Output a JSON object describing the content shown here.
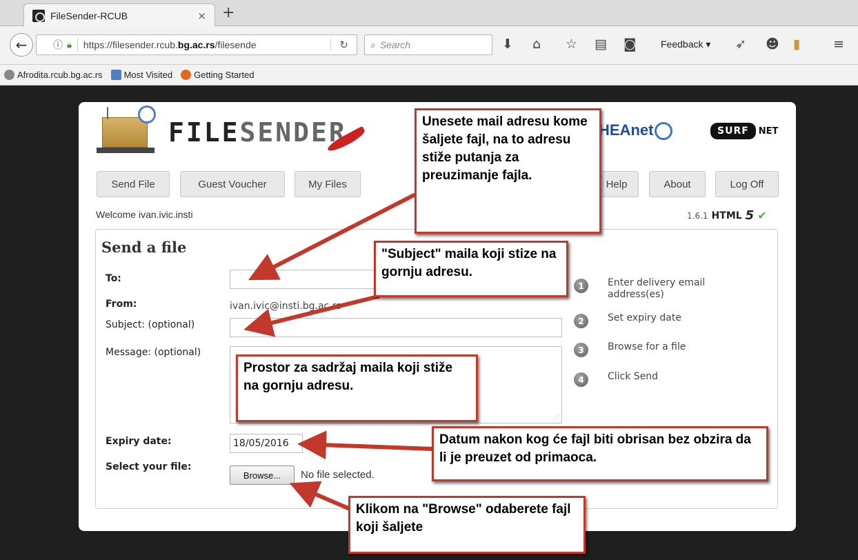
{
  "browser": {
    "tab_title": "FileSender-RCUB",
    "tab_close": "×",
    "new_tab": "+",
    "url_prefix": "https://filesender.rcub.",
    "url_domain": "bg.ac.rs",
    "url_suffix": "/filesende",
    "search_placeholder": "Search",
    "feedback_label": "Feedback ▾",
    "bookmarks": [
      "Afrodita.rcub.bg.ac.rs",
      "Most Visited",
      "Getting Started"
    ]
  },
  "header": {
    "logo_main": "FILE",
    "logo_lite": "SENDER",
    "heanet": "HEAnet",
    "surf": "SURF",
    "net": "NET"
  },
  "nav": {
    "send_file": "Send File",
    "guest_voucher": "Guest Voucher",
    "my_files": "My Files",
    "help": "Help",
    "about": "About",
    "log_off": "Log Off"
  },
  "welcome": "Welcome ivan.ivic.insti",
  "version": {
    "number": "1.6.1",
    "html": "HTML",
    "five": "5",
    "check": "✔"
  },
  "form": {
    "title": "Send a file",
    "to_label": "To:",
    "from_label": "From:",
    "from_value": "ivan.ivic@insti.bg.ac.rs",
    "subject_label": "Subject: (optional)",
    "message_label": "Message: (optional)",
    "expiry_label": "Expiry date:",
    "expiry_value": "18/05/2016",
    "file_label": "Select your file:",
    "browse_label": "Browse...",
    "no_file": "No file selected."
  },
  "steps": [
    {
      "num": "1",
      "text": "Enter delivery email address(es)"
    },
    {
      "num": "2",
      "text": "Set expiry date"
    },
    {
      "num": "3",
      "text": "Browse for a file"
    },
    {
      "num": "4",
      "text": "Click Send"
    }
  ],
  "callouts": {
    "to": "Unesete mail adresu kome šaljete fajl, na to adresu stiže putanja za preuzimanje fajla.",
    "subject": "\"Subject\" maila koji stize na gornju adresu.",
    "message": "Prostor za sadržaj maila koji stiže na gornju adresu.",
    "expiry": "Datum nakon kog će fajl biti obrisan bez obzira da li je preuzet od primaoca.",
    "browse": "Klikom  na \"Browse\" odaberete fajl koji šaljete"
  },
  "colors": {
    "callout_border": "#c0392b",
    "arrow": "#c0392b"
  }
}
